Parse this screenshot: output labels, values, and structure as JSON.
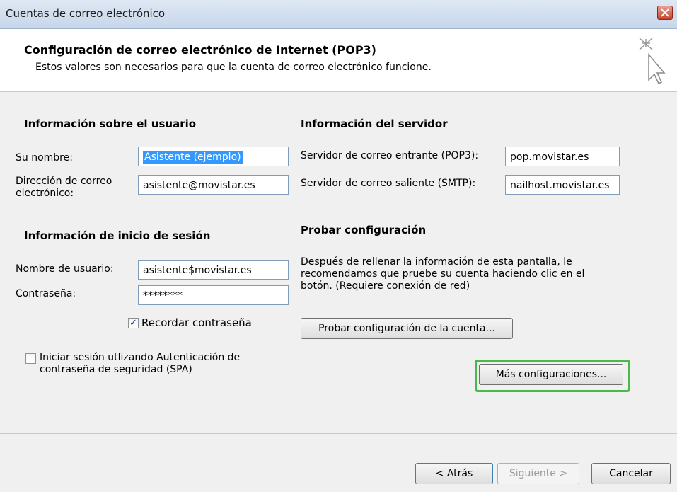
{
  "window": {
    "title": "Cuentas de correo electrónico"
  },
  "header": {
    "title": "Configuración de correo electrónico de Internet (POP3)",
    "subtitle": "Estos valores son necesarios para que la cuenta de correo electrónico funcione."
  },
  "user_info": {
    "heading": "Información sobre el usuario",
    "name_label": "Su nombre:",
    "name_value": "Asistente (ejemplo)",
    "email_label": "Dirección de correo electrónico:",
    "email_value": "asistente@movistar.es"
  },
  "login_info": {
    "heading": "Información de inicio de sesión",
    "username_label": "Nombre de usuario:",
    "username_value": "asistente$movistar.es",
    "password_label": "Contraseña:",
    "password_value": "********",
    "remember_label": "Recordar contraseña",
    "remember_checked": true,
    "spa_label": "Iniciar sesión utlizando Autenticación de contraseña de seguridad (SPA)",
    "spa_checked": false
  },
  "server_info": {
    "heading": "Información del servidor",
    "incoming_label": "Servidor de correo entrante (POP3):",
    "incoming_value": "pop.movistar.es",
    "outgoing_label": "Servidor de correo saliente (SMTP):",
    "outgoing_value": "nailhost.movistar.es"
  },
  "test": {
    "heading": "Probar configuración",
    "description": "Después de rellenar la información de esta pantalla, le recomendamos que pruebe su cuenta haciendo clic en el botón. (Requiere conexión de red)",
    "test_button": "Probar configuración de la cuenta...",
    "more_button": "Más configuraciones..."
  },
  "footer": {
    "back": "< Atrás",
    "next": "Siguiente >",
    "cancel": "Cancelar"
  },
  "colors": {
    "highlight": "#4cb848",
    "selection": "#3399ff"
  }
}
